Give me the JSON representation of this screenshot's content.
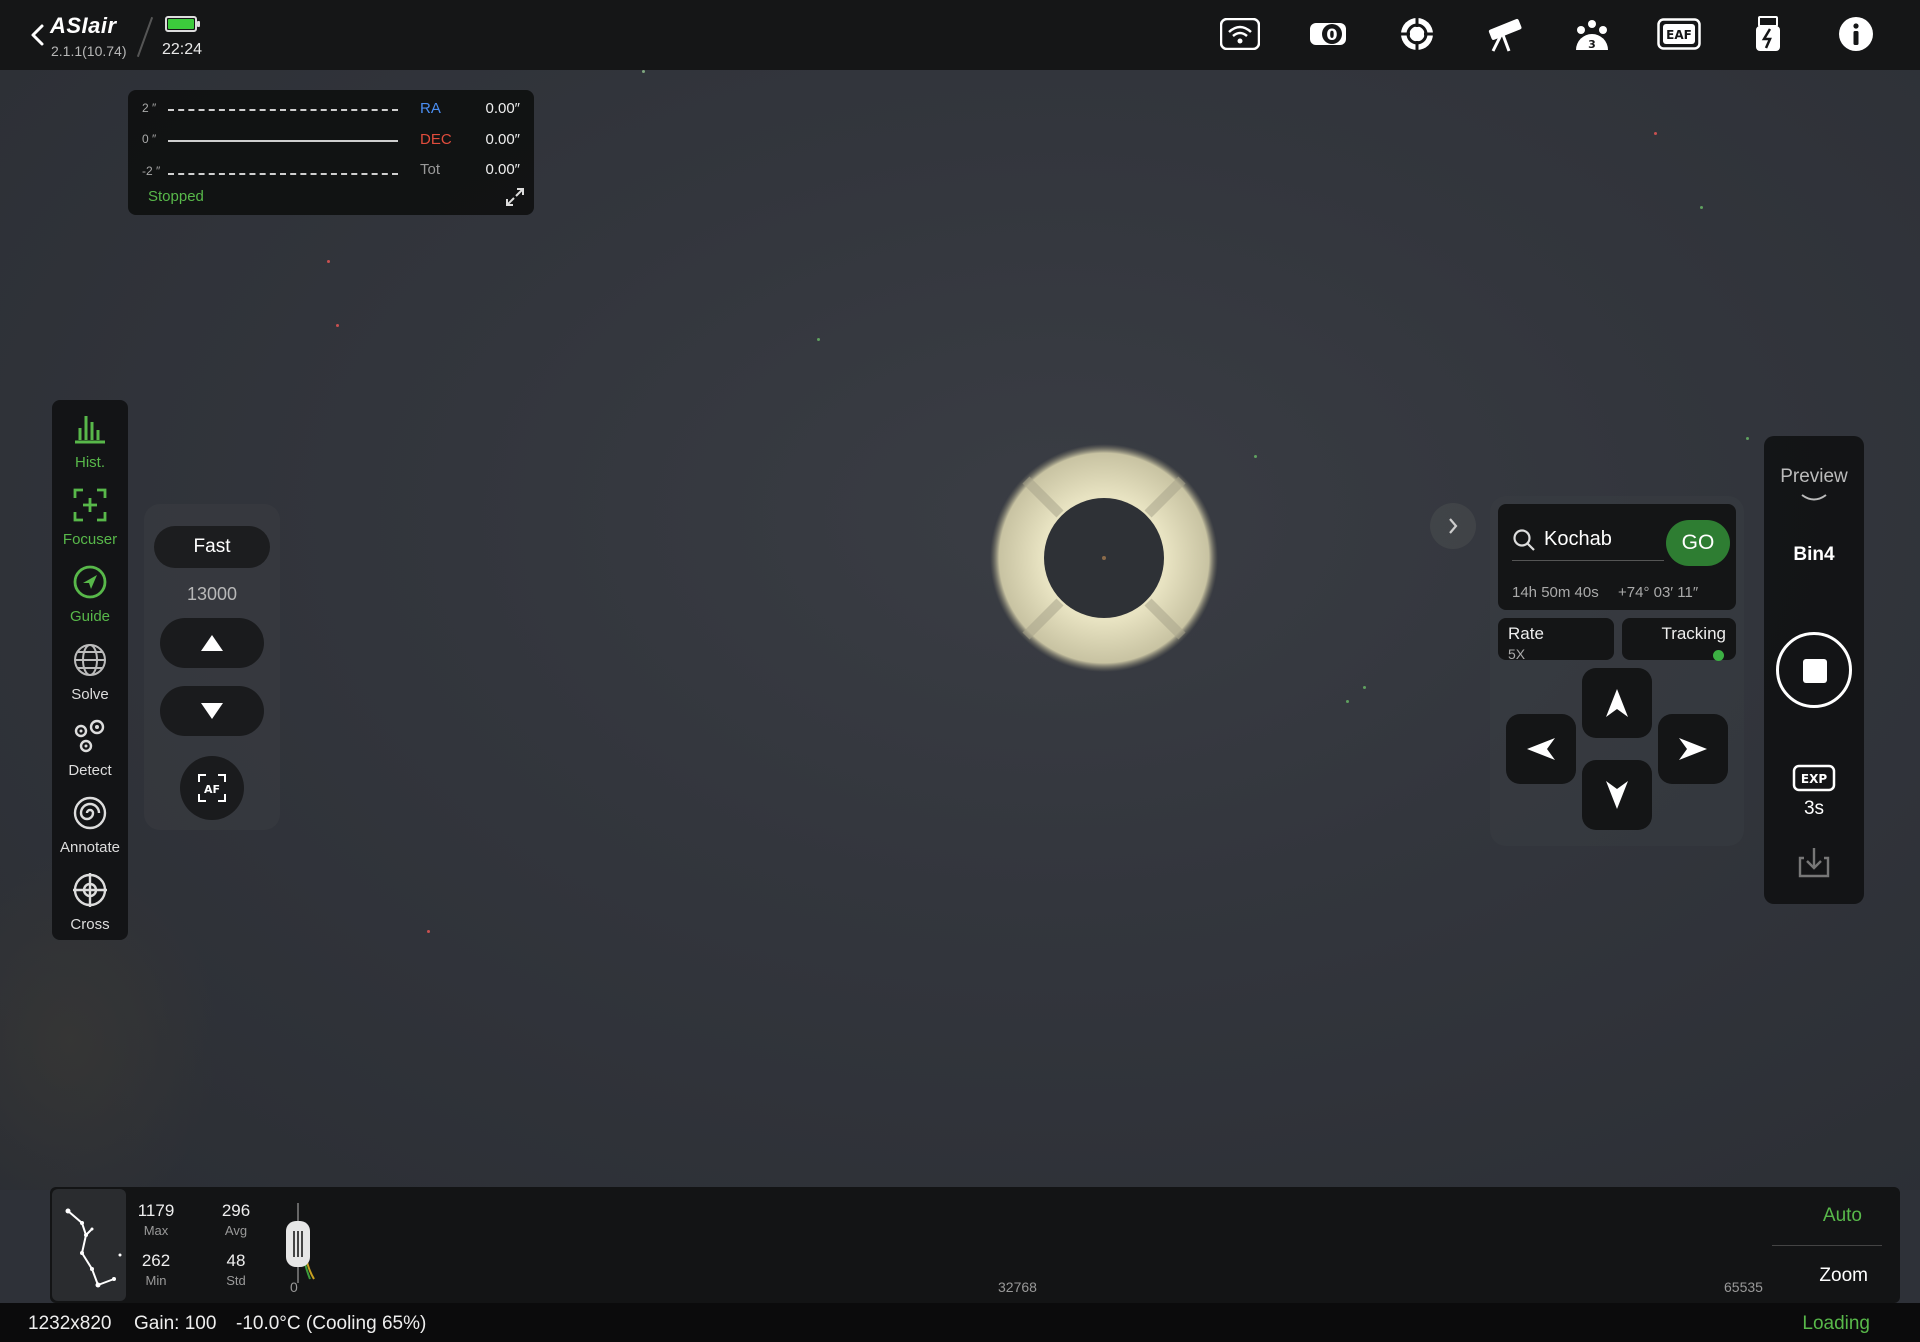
{
  "app": {
    "logo": "ASIair",
    "version": "2.1.1(10.74)",
    "time": "22:24",
    "battery_color": "#3ccb3c"
  },
  "top_icons": [
    "wifi-icon",
    "camera-icon",
    "guide-scope-icon",
    "telescope-icon",
    "filter-wheel-icon",
    "eaf-icon",
    "storage-icon",
    "info-icon"
  ],
  "filter_wheel_slot": "3",
  "eaf_label": "EAF",
  "guide_graph": {
    "ticks": [
      "2 ″",
      "0 ″",
      "-2 ″"
    ],
    "rows": [
      {
        "label": "RA",
        "value": "0.00″",
        "color": "#4a8ef2"
      },
      {
        "label": "DEC",
        "value": "0.00″",
        "color": "#e04c3c"
      },
      {
        "label": "Tot",
        "value": "0.00″",
        "color": "#999999"
      }
    ],
    "status": "Stopped"
  },
  "tools": [
    {
      "name": "hist",
      "label": "Hist.",
      "active": true
    },
    {
      "name": "focuser",
      "label": "Focuser",
      "active": true
    },
    {
      "name": "guide",
      "label": "Guide",
      "active": true
    },
    {
      "name": "solve",
      "label": "Solve",
      "active": false
    },
    {
      "name": "detect",
      "label": "Detect",
      "active": false
    },
    {
      "name": "annotate",
      "label": "Annotate",
      "active": false
    },
    {
      "name": "cross",
      "label": "Cross",
      "active": false
    }
  ],
  "focuser": {
    "speed": "Fast",
    "position": "13000",
    "af_label": "AF"
  },
  "mount": {
    "target": "Kochab",
    "go_label": "GO",
    "ra": "14h 50m 40s",
    "dec": "+74° 03′ 11″",
    "rate_label": "Rate",
    "rate_value": "5X",
    "tracking_label": "Tracking",
    "tracking_on": true
  },
  "capture": {
    "mode": "Preview",
    "bin": "Bin4",
    "exp_label": "EXP",
    "exposure": "3s"
  },
  "histogram": {
    "max": "1179",
    "max_label": "Max",
    "avg": "296",
    "avg_label": "Avg",
    "min": "262",
    "min_label": "Min",
    "std": "48",
    "std_label": "Std",
    "tick_low": "0",
    "tick_mid": "32768",
    "tick_high": "65535",
    "auto_label": "Auto",
    "zoom_label": "Zoom"
  },
  "status": {
    "resolution": "1232x820",
    "gain": "Gain: 100",
    "temperature": "-10.0°C (Cooling 65%)",
    "state": "Loading"
  },
  "colors": {
    "accent_green": "#58b84a",
    "go_green": "#2e7d32",
    "donut": "#e8e3c2"
  }
}
